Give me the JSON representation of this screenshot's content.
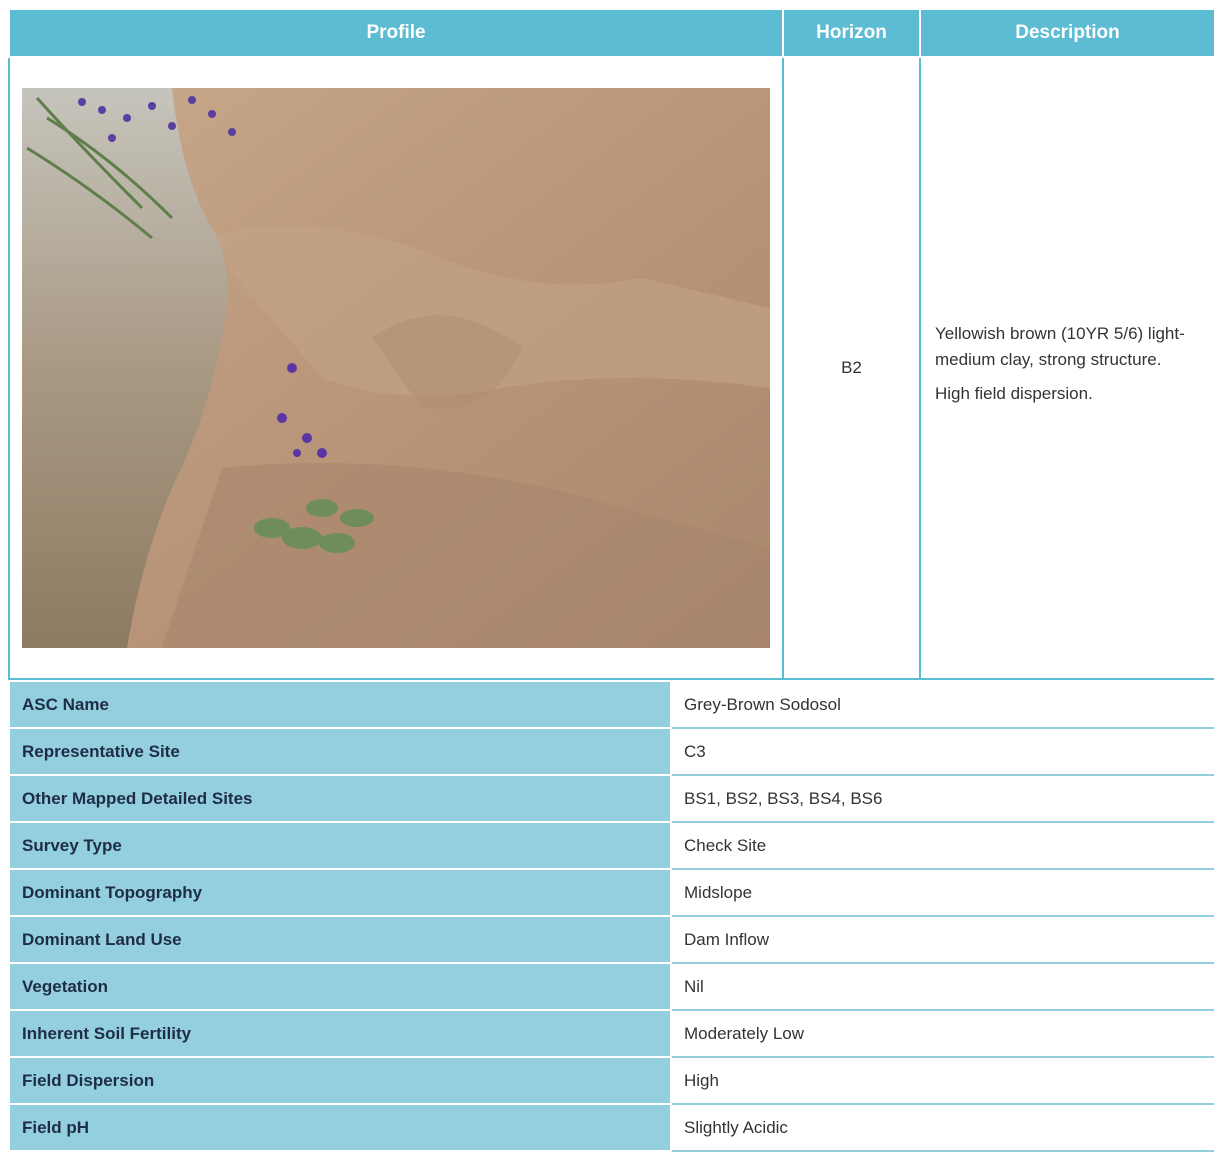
{
  "header": {
    "profile": "Profile",
    "horizon": "Horizon",
    "description": "Description"
  },
  "profile": {
    "horizon": "B2",
    "description_lines": [
      "Yellowish brown (10YR 5/6) light-medium clay, strong structure.",
      "High field dispersion."
    ]
  },
  "attributes": [
    {
      "label": "ASC Name",
      "value": "Grey-Brown Sodosol"
    },
    {
      "label": "Representative Site",
      "value": "C3"
    },
    {
      "label": "Other Mapped Detailed Sites",
      "value": "BS1, BS2, BS3, BS4, BS6"
    },
    {
      "label": "Survey Type",
      "value": "Check Site"
    },
    {
      "label": "Dominant Topography",
      "value": "Midslope"
    },
    {
      "label": "Dominant Land Use",
      "value": "Dam Inflow"
    },
    {
      "label": "Vegetation",
      "value": "Nil"
    },
    {
      "label": "Inherent Soil Fertility",
      "value": "Moderately Low"
    },
    {
      "label": "Field Dispersion",
      "value": "High"
    },
    {
      "label": "Field pH",
      "value": "Slightly Acidic"
    }
  ],
  "colors": {
    "header_bg": "#5bbcd3",
    "label_bg": "#93cfdf"
  }
}
